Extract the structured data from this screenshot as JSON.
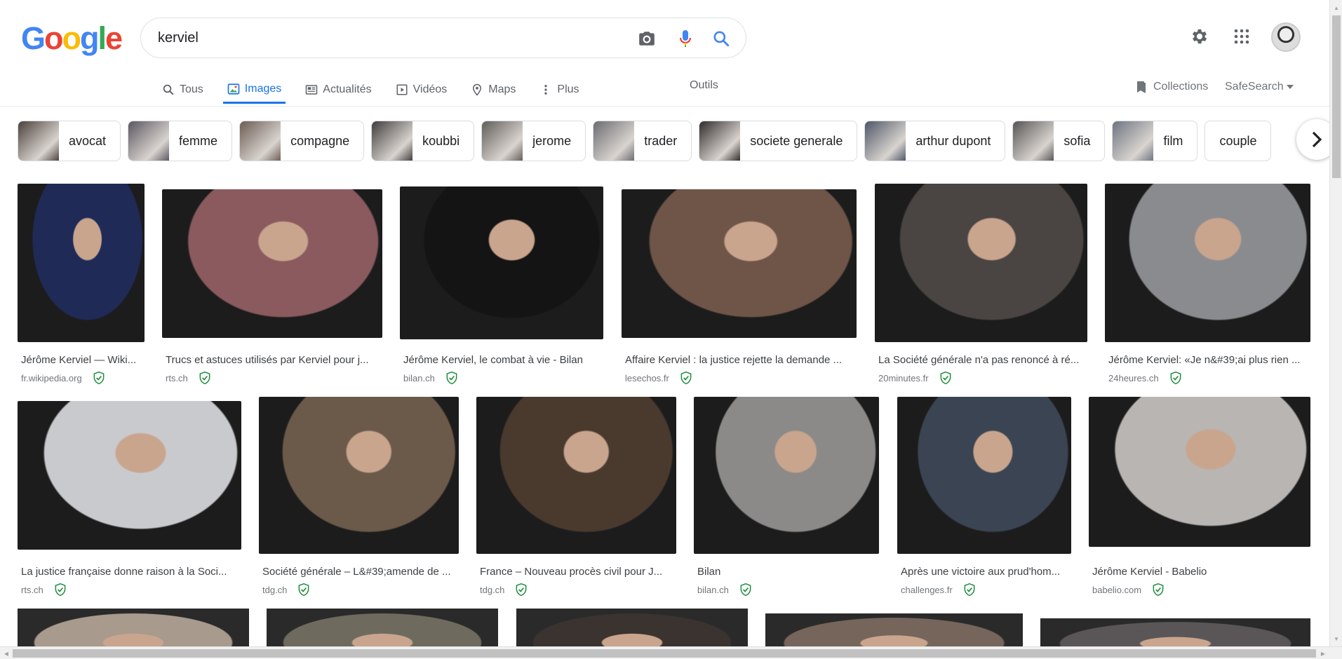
{
  "logo": {
    "letters": [
      "G",
      "o",
      "o",
      "g",
      "l",
      "e"
    ],
    "colors": [
      "#4285F4",
      "#EA4335",
      "#FBBC05",
      "#4285F4",
      "#34A853",
      "#EA4335"
    ]
  },
  "search": {
    "query": "kerviel"
  },
  "accent": "#1a73e8",
  "icons": {
    "camera": "camera-icon",
    "mic": "microphone-icon",
    "search": "search-icon",
    "settings": "gear-icon",
    "apps": "apps-grid-icon"
  },
  "tabs": [
    {
      "label": "Tous",
      "icon": "search-icon",
      "active": false
    },
    {
      "label": "Images",
      "icon": "image-icon",
      "active": true
    },
    {
      "label": "Actualités",
      "icon": "news-icon",
      "active": false
    },
    {
      "label": "Vidéos",
      "icon": "video-icon",
      "active": false
    },
    {
      "label": "Maps",
      "icon": "map-pin-icon",
      "active": false
    },
    {
      "label": "Plus",
      "icon": "more-vert-icon",
      "active": false
    }
  ],
  "tools_label": "Outils",
  "collections_label": "Collections",
  "safesearch_label": "SafeSearch",
  "chips": [
    {
      "label": "avocat",
      "thumb": "#4a3f3a"
    },
    {
      "label": "femme",
      "thumb": "#5a5560"
    },
    {
      "label": "compagne",
      "thumb": "#6b5a52"
    },
    {
      "label": "koubbi",
      "thumb": "#3e3b3b"
    },
    {
      "label": "jerome",
      "thumb": "#5f5b57"
    },
    {
      "label": "trader",
      "thumb": "#6a6a70"
    },
    {
      "label": "societe generale",
      "thumb": "#2e2a2a"
    },
    {
      "label": "arthur dupont",
      "thumb": "#4c5566"
    },
    {
      "label": "sofia",
      "thumb": "#555353"
    },
    {
      "label": "film",
      "thumb": "#6c7380"
    },
    {
      "label": "couple",
      "thumb": ""
    }
  ],
  "results": [
    {
      "title": "Jérôme Kerviel — Wiki...",
      "source": "fr.wikipedia.org",
      "color": "#1f2a57"
    },
    {
      "title": "Trucs et astuces utilisés par Kerviel pour j...",
      "source": "rts.ch",
      "color": "#8a5a5f"
    },
    {
      "title": "Jérôme Kerviel, le combat à vie - Bilan",
      "source": "bilan.ch",
      "color": "#141414"
    },
    {
      "title": "Affaire Kerviel : la justice rejette la demande ...",
      "source": "lesechos.fr",
      "color": "#6e5548"
    },
    {
      "title": "La Société générale n'a pas renoncé à ré...",
      "source": "20minutes.fr",
      "color": "#4a4442"
    },
    {
      "title": "Jérôme Kerviel: «Je n&#39;ai plus rien ...",
      "source": "24heures.ch",
      "color": "#8a8b8f"
    },
    {
      "title": "La justice française donne raison à la Soci...",
      "source": "rts.ch",
      "color": "#c9cace"
    },
    {
      "title": "Société générale – L&#39;amende de ...",
      "source": "tdg.ch",
      "color": "#6b5a4a"
    },
    {
      "title": "France – Nouveau procès civil pour J...",
      "source": "tdg.ch",
      "color": "#4a3a2e"
    },
    {
      "title": "Bilan",
      "source": "bilan.ch",
      "color": "#8c8a88"
    },
    {
      "title": "Après une victoire aux prud'hom...",
      "source": "challenges.fr",
      "color": "#3b4452"
    },
    {
      "title": "Jérôme Kerviel - Babelio",
      "source": "babelio.com",
      "color": "#b9b5b2"
    }
  ],
  "partial_results": [
    {
      "color": "#a89a8c"
    },
    {
      "color": "#6e6a5e"
    },
    {
      "color": "#3a3330"
    },
    {
      "color": "#75655a"
    },
    {
      "color": "#5a5658"
    }
  ]
}
